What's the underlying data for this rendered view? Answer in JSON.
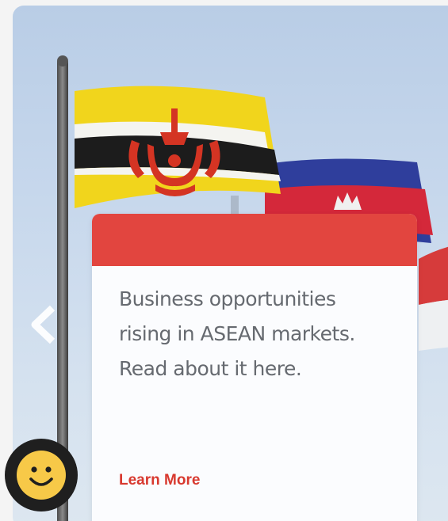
{
  "promo": {
    "text_line1": "Business opportunities",
    "text_line2": "rising in ASEAN markets.",
    "text_line3": "Read about it here.",
    "link_label": "Learn More"
  },
  "colors": {
    "accent": "#e2453f",
    "link": "#d8392f",
    "text": "#666a70",
    "card_bg": "#fbfcfe",
    "feedback_bg": "#1f1f1f",
    "feedback_face": "#f7c948"
  },
  "icons": {
    "previous": "chevron-left-icon",
    "feedback": "smiley-icon"
  }
}
